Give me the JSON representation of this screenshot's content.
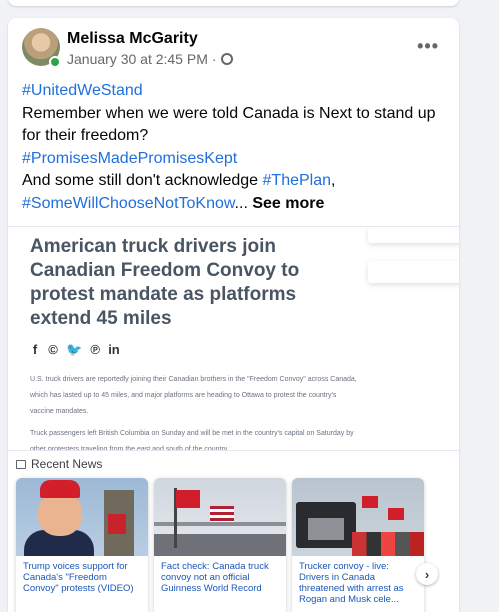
{
  "post": {
    "author": "Melissa McGarity",
    "timestamp": "January 30 at 2:45 PM",
    "separator": "·",
    "more_label": "•••",
    "line1_tag": "#UnitedWeStand",
    "line2": "Remember when we were told Canada is Next to stand up for their freedom?",
    "line3_tag": "#PromisesMadePromisesKept",
    "line4_text": "And some still don't acknowledge ",
    "line4_tag": "#ThePlan",
    "line4_end": ",",
    "line5_tag": "#SomeWillChooseNotToKnow",
    "ellipsis": "... ",
    "see_more": "See more"
  },
  "article": {
    "title": "American truck drivers join Canadian Freedom Convoy to protest mandate as platforms extend 45 miles",
    "share_icons": [
      "f",
      "©",
      "🐦",
      "℗",
      "in"
    ],
    "paragraph1": "U.S. truck drivers are reportedly joining their Canadian brothers in the \"Freedom Convoy\" across Canada, which has lasted up to 45 miles, and major platforms are heading to Ottawa to protest the country's vaccine mandates.",
    "paragraph2": "Truck passengers left British Columbia on Sunday and will be met in the country's capital on Saturday by other protesters traveling from the east and south of the country."
  },
  "recent_news": {
    "heading": "Recent News",
    "items": [
      {
        "caption": "Trump voices support for Canada's \"Freedom Convoy\" protests (VIDEO)"
      },
      {
        "caption": "Fact check: Canada truck convoy not an official Guinness World Record"
      },
      {
        "caption": "Trucker convoy - live: Drivers in Canada threatened with arrest as Rogan and Musk cele..."
      }
    ],
    "next_label": "›"
  },
  "colors": {
    "link": "#216fdb",
    "online": "#31a24c",
    "news_link": "#1a56b8"
  }
}
